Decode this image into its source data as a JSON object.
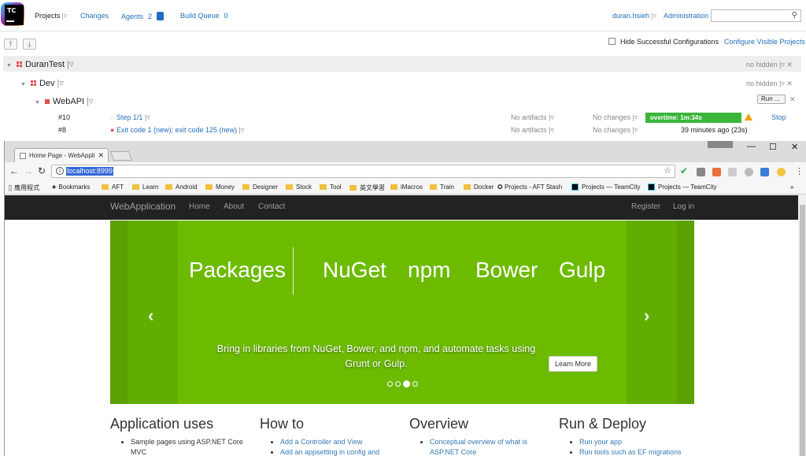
{
  "teamcity": {
    "logo_text": "TC",
    "nav": {
      "projects": "Projects",
      "changes": "Changes",
      "agents": "Agents",
      "agents_count": "2",
      "build_queue": "Build Queue",
      "build_queue_count": "0"
    },
    "user": "duran.hsieh",
    "administration": "Administration",
    "hide_successful": "Hide Successful Configurations",
    "configure_visible": "Configure Visible Projects",
    "project": {
      "name": "DuranTest",
      "hidden": "no hidden"
    },
    "subproject": {
      "name": "Dev",
      "hidden": "no hidden"
    },
    "build_config": {
      "name": "WebAPI",
      "run_label": "Run",
      "run_more": "..."
    },
    "builds": [
      {
        "number": "#10",
        "status": "Step 1/1",
        "artifacts": "No artifacts",
        "changes": "No changes",
        "overtime": "overtime: 1m:34s",
        "action": "Stop"
      },
      {
        "number": "#8",
        "status": "Exit code 1 (new); exit code 125 (new)",
        "artifacts": "No artifacts",
        "changes": "No changes",
        "time": "39 minutes ago (23s)"
      }
    ],
    "colors": {
      "link": "#1f6fbf",
      "success": "#3cb53c",
      "error": "#e05050"
    }
  },
  "browser": {
    "tab_title": "Home Page - WebAppli",
    "url": "localhost:8999",
    "bookmarks": [
      "應用程式",
      "Bookmarks",
      "AFT",
      "Learn",
      "Android",
      "Money",
      "Designer",
      "Stock",
      "Tool",
      "英文學習",
      "iMacros",
      "Train",
      "Docker",
      "Projects - AFT Stash",
      "Projects — TeamCity",
      "Projects — TeamCity"
    ],
    "more_bookmarks": "»"
  },
  "site": {
    "brand": "WebApplication",
    "nav": [
      "Home",
      "About",
      "Contact"
    ],
    "register": "Register",
    "login": "Log in",
    "carousel": {
      "items": [
        "Packages",
        "NuGet",
        "npm",
        "Bower",
        "Gulp"
      ],
      "caption": "Bring in libraries from NuGet, Bower, and npm, and automate tasks using Grunt or Gulp.",
      "button": "Learn More",
      "active_slide": 3,
      "slide_count": 4,
      "color": "#6cbb00"
    },
    "columns": [
      {
        "title": "Application uses",
        "items": [
          "Sample pages using ASP.NET Core MVC"
        ]
      },
      {
        "title": "How to",
        "items": [
          "Add a Controller and View",
          "Add an appsetting in config and"
        ]
      },
      {
        "title": "Overview",
        "items": [
          "Conceptual overview of what is ASP.NET Core"
        ]
      },
      {
        "title": "Run & Deploy",
        "items": [
          "Run your app",
          "Run tools such as EF migrations"
        ]
      }
    ]
  }
}
